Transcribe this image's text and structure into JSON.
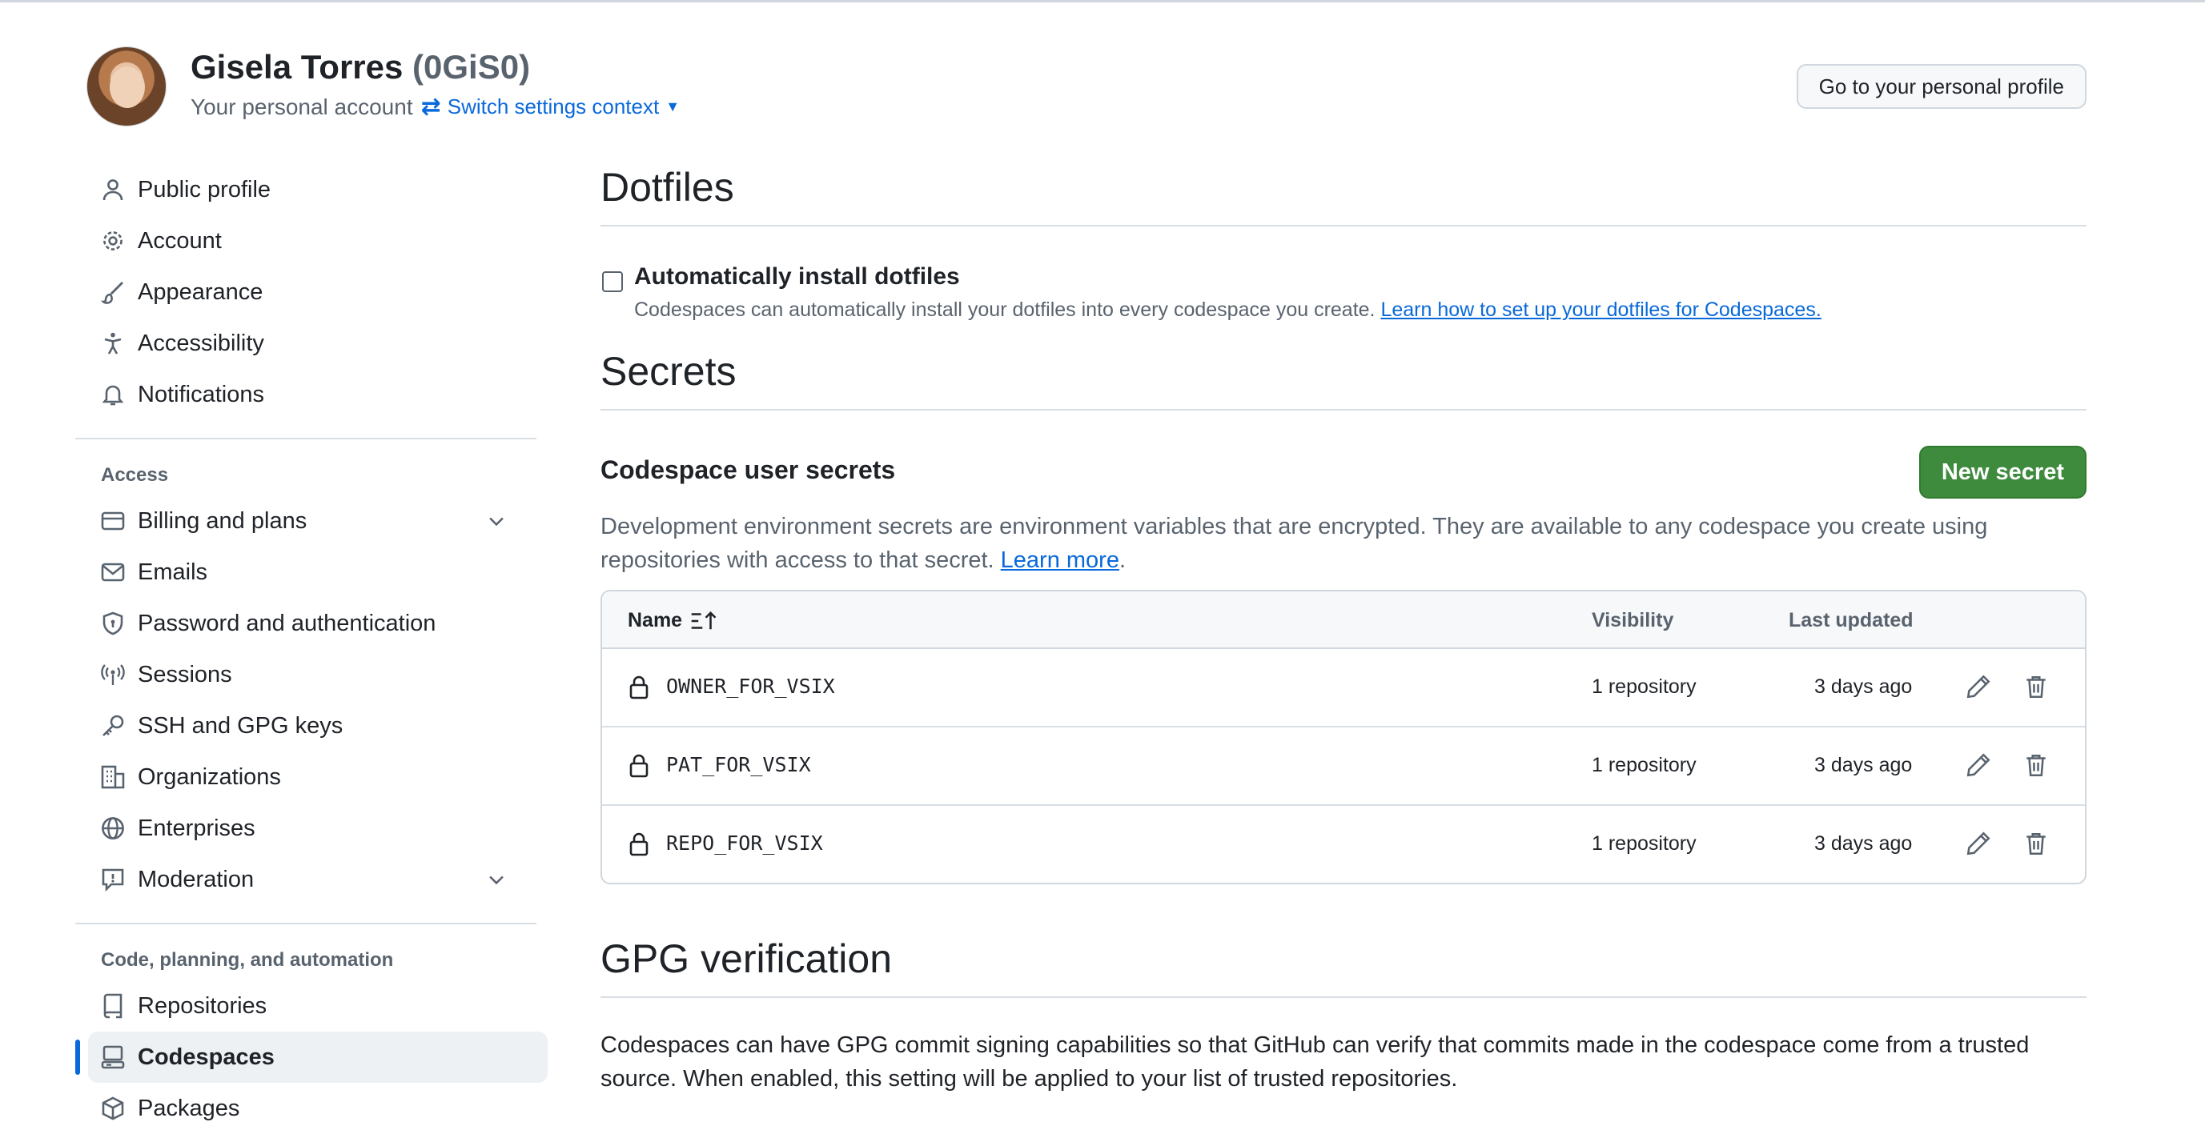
{
  "header": {
    "name": "Gisela Torres",
    "handle": "(0GiS0)",
    "subtitle": "Your personal account",
    "switch_label": "Switch settings context",
    "profile_button": "Go to your personal profile"
  },
  "sidebar": {
    "top_items": [
      {
        "label": "Public profile",
        "icon": "person-icon"
      },
      {
        "label": "Account",
        "icon": "gear-icon"
      },
      {
        "label": "Appearance",
        "icon": "paintbrush-icon"
      },
      {
        "label": "Accessibility",
        "icon": "accessibility-icon"
      },
      {
        "label": "Notifications",
        "icon": "bell-icon"
      }
    ],
    "access_heading": "Access",
    "access_items": [
      {
        "label": "Billing and plans",
        "icon": "credit-card-icon",
        "expandable": true
      },
      {
        "label": "Emails",
        "icon": "mail-icon"
      },
      {
        "label": "Password and authentication",
        "icon": "shield-icon"
      },
      {
        "label": "Sessions",
        "icon": "broadcast-icon"
      },
      {
        "label": "SSH and GPG keys",
        "icon": "key-icon"
      },
      {
        "label": "Organizations",
        "icon": "organization-icon"
      },
      {
        "label": "Enterprises",
        "icon": "globe-icon"
      },
      {
        "label": "Moderation",
        "icon": "report-icon",
        "expandable": true
      }
    ],
    "code_heading": "Code, planning, and automation",
    "code_items": [
      {
        "label": "Repositories",
        "icon": "repo-icon"
      },
      {
        "label": "Codespaces",
        "icon": "codespaces-icon",
        "active": true
      },
      {
        "label": "Packages",
        "icon": "package-icon"
      }
    ]
  },
  "dotfiles": {
    "title": "Dotfiles",
    "checkbox_label": "Automatically install dotfiles",
    "checked": false,
    "note": "Codespaces can automatically install your dotfiles into every codespace you create. ",
    "link": "Learn how to set up your dotfiles for Codespaces."
  },
  "secrets": {
    "title": "Secrets",
    "subtitle": "Codespace user secrets",
    "new_button": "New secret",
    "description": "Development environment secrets are environment variables that are encrypted. They are available to any codespace you create using repositories with access to that secret. ",
    "learn_more": "Learn more",
    "period": ".",
    "columns": {
      "name": "Name",
      "visibility": "Visibility",
      "updated": "Last updated"
    },
    "rows": [
      {
        "name": "OWNER_FOR_VSIX",
        "visibility": "1 repository",
        "updated": "3 days ago"
      },
      {
        "name": "PAT_FOR_VSIX",
        "visibility": "1 repository",
        "updated": "3 days ago"
      },
      {
        "name": "REPO_FOR_VSIX",
        "visibility": "1 repository",
        "updated": "3 days ago"
      }
    ]
  },
  "gpg": {
    "title": "GPG verification",
    "description": "Codespaces can have GPG commit signing capabilities so that GitHub can verify that commits made in the codespace come from a trusted source. When enabled, this setting will be applied to your list of trusted repositories."
  },
  "colors": {
    "accent": "#0969da",
    "primary_button": "#3e8b3e",
    "border": "#d0d7de",
    "muted_text": "#59636e"
  }
}
